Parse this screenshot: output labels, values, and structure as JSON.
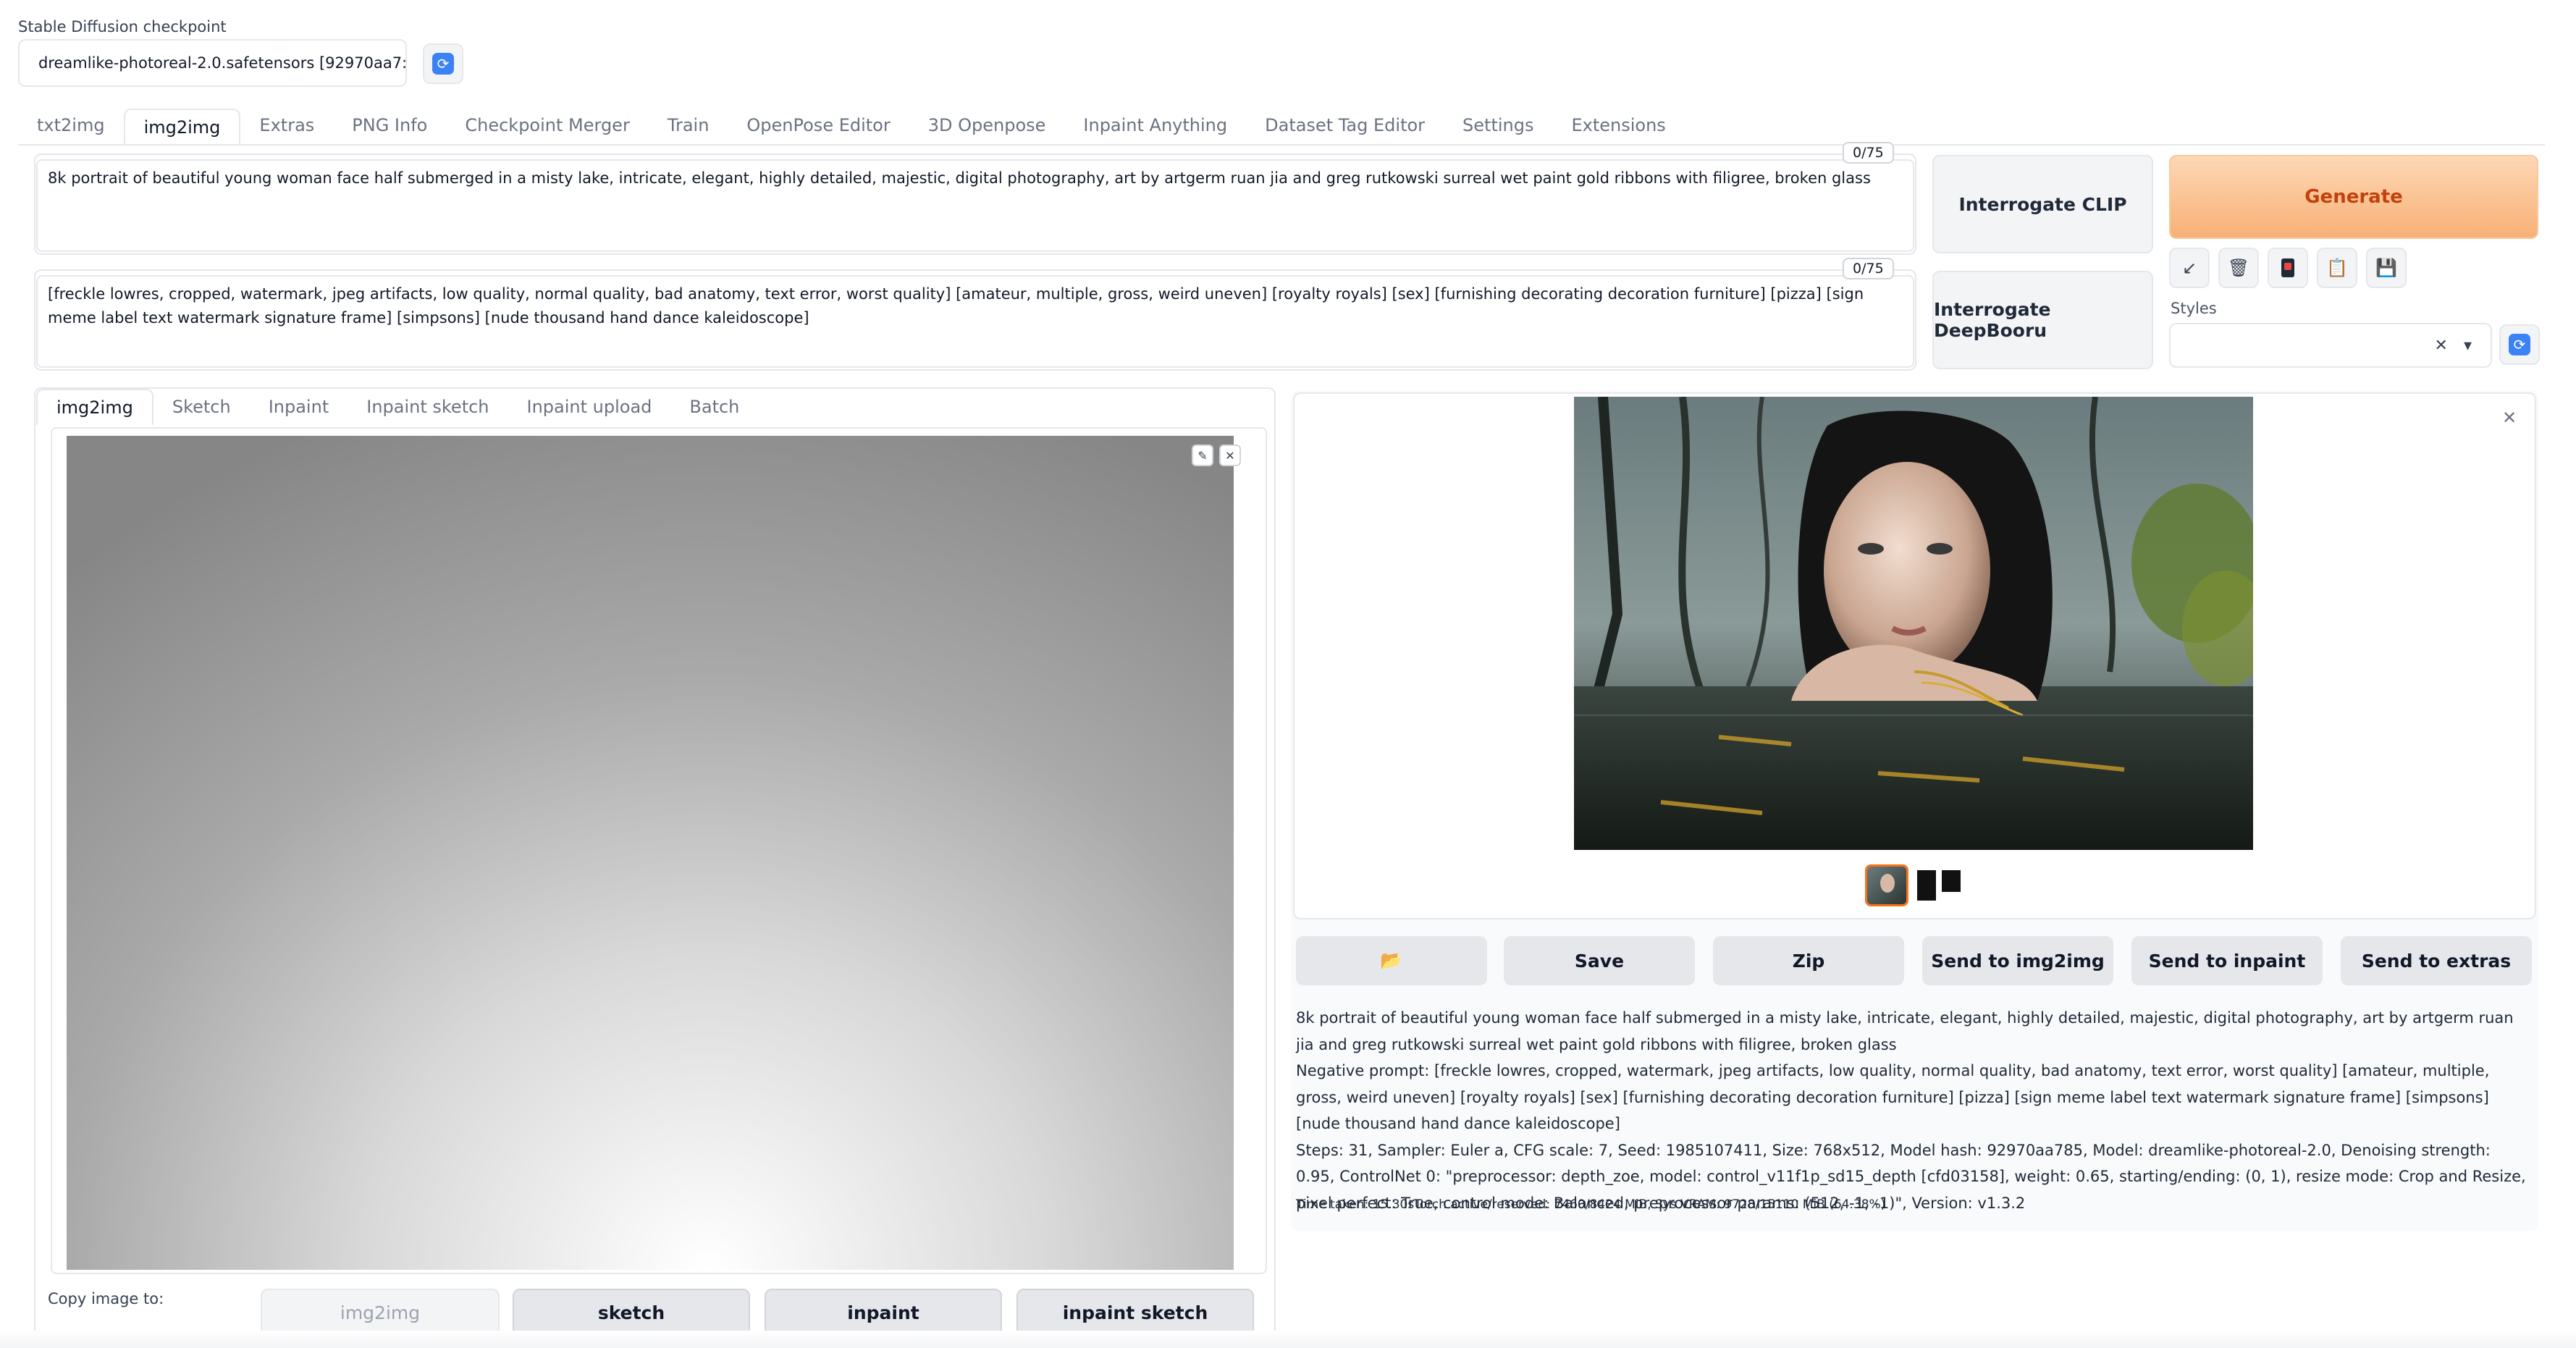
{
  "checkpoint": {
    "label": "Stable Diffusion checkpoint",
    "value": "dreamlike-photoreal-2.0.safetensors [92970aa7:"
  },
  "main_tabs": [
    "txt2img",
    "img2img",
    "Extras",
    "PNG Info",
    "Checkpoint Merger",
    "Train",
    "OpenPose Editor",
    "3D Openpose",
    "Inpaint Anything",
    "Dataset Tag Editor",
    "Settings",
    "Extensions"
  ],
  "active_main_tab": "img2img",
  "prompt": {
    "text": "8k portrait of beautiful young woman face half submerged in a misty lake, intricate, elegant, highly detailed, majestic, digital photography, art by artgerm ruan jia and greg rutkowski surreal wet paint gold ribbons with filigree, broken glass",
    "counter": "0/75"
  },
  "negative_prompt": {
    "text": "[freckle lowres, cropped, watermark, jpeg artifacts, low quality, normal quality, bad anatomy, text error, worst quality] [amateur, multiple, gross, weird uneven] [royalty royals] [sex] [furnishing decorating decoration furniture] [pizza] [sign meme label text watermark signature frame] [simpsons] [nude thousand hand dance kaleidoscope]",
    "counter": "0/75"
  },
  "buttons": {
    "interrogate_clip": "Interrogate CLIP",
    "interrogate_deepbooru": "Interrogate DeepBooru",
    "generate": "Generate"
  },
  "styles": {
    "label": "Styles",
    "clear": "✕",
    "caret": "▾"
  },
  "sub_tabs": [
    "img2img",
    "Sketch",
    "Inpaint",
    "Inpaint sketch",
    "Inpaint upload",
    "Batch"
  ],
  "copy_image": {
    "label": "Copy image to:",
    "targets": [
      "img2img",
      "sketch",
      "inpaint",
      "inpaint sketch"
    ]
  },
  "output_actions": [
    "📂",
    "Save",
    "Zip",
    "Send to img2img",
    "Send to inpaint",
    "Send to extras"
  ],
  "generation_info": {
    "prompt": "8k portrait of beautiful young woman face half submerged in a misty lake, intricate, elegant, highly detailed, majestic, digital photography, art by artgerm ruan jia and greg rutkowski surreal wet paint gold ribbons with filigree, broken glass",
    "negative": "Negative prompt: [freckle lowres, cropped, watermark, jpeg artifacts, low quality, normal quality, bad anatomy, text error, worst quality] [amateur, multiple, gross, weird uneven] [royalty royals] [sex] [furnishing decorating decoration furniture] [pizza] [sign meme label text watermark signature frame] [simpsons] [nude thousand hand dance kaleidoscope]",
    "params": "Steps: 31, Sampler: Euler a, CFG scale: 7, Seed: 1985107411, Size: 768x512, Model hash: 92970aa785, Model: dreamlike-photoreal-2.0, Denoising strength: 0.95, ControlNet 0: \"preprocessor: depth_zoe, model: control_v11f1p_sd15_depth [cfd03158], weight: 0.65, starting/ending: (0, 1), resize mode: Crop and Resize, pixel perfect: True, control mode: Balanced, preprocessor params: (512, -1, -1)\", Version: v1.3.2",
    "time": "Time taken: 15.30sTorch active/reserved: 7460/8424 MiB, Sys VRAM: 9728/15110 MiB (64.38%)"
  },
  "colors": {
    "accent": "#f97316",
    "generate_text": "#c2410c",
    "refresh": "#3b82f6"
  }
}
